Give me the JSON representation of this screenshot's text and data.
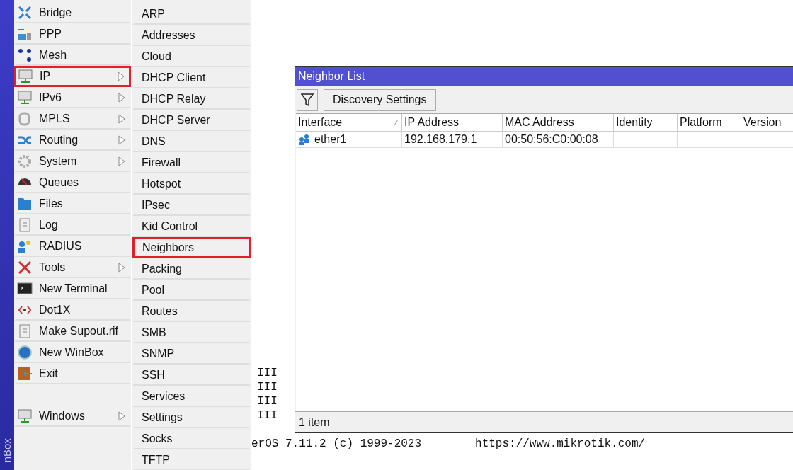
{
  "side_strip": {
    "label": "nBox"
  },
  "main_menu": [
    {
      "label": "Bridge",
      "submenu": false,
      "highlighted": false
    },
    {
      "label": "PPP",
      "submenu": false,
      "highlighted": false
    },
    {
      "label": "Mesh",
      "submenu": false,
      "highlighted": false
    },
    {
      "label": "IP",
      "submenu": true,
      "highlighted": true
    },
    {
      "label": "IPv6",
      "submenu": true,
      "highlighted": false
    },
    {
      "label": "MPLS",
      "submenu": true,
      "highlighted": false
    },
    {
      "label": "Routing",
      "submenu": true,
      "highlighted": false
    },
    {
      "label": "System",
      "submenu": true,
      "highlighted": false
    },
    {
      "label": "Queues",
      "submenu": false,
      "highlighted": false
    },
    {
      "label": "Files",
      "submenu": false,
      "highlighted": false
    },
    {
      "label": "Log",
      "submenu": false,
      "highlighted": false
    },
    {
      "label": "RADIUS",
      "submenu": false,
      "highlighted": false
    },
    {
      "label": "Tools",
      "submenu": true,
      "highlighted": false
    },
    {
      "label": "New Terminal",
      "submenu": false,
      "highlighted": false
    },
    {
      "label": "Dot1X",
      "submenu": false,
      "highlighted": false
    },
    {
      "label": "Make Supout.rif",
      "submenu": false,
      "highlighted": false
    },
    {
      "label": "New WinBox",
      "submenu": false,
      "highlighted": false
    },
    {
      "label": "Exit",
      "submenu": false,
      "highlighted": false
    },
    {
      "label": "Windows",
      "submenu": true,
      "highlighted": false,
      "gap_before": true
    }
  ],
  "ip_submenu": [
    {
      "label": "ARP",
      "highlighted": false
    },
    {
      "label": "Addresses",
      "highlighted": false
    },
    {
      "label": "Cloud",
      "highlighted": false
    },
    {
      "label": "DHCP Client",
      "highlighted": false
    },
    {
      "label": "DHCP Relay",
      "highlighted": false
    },
    {
      "label": "DHCP Server",
      "highlighted": false
    },
    {
      "label": "DNS",
      "highlighted": false
    },
    {
      "label": "Firewall",
      "highlighted": false
    },
    {
      "label": "Hotspot",
      "highlighted": false
    },
    {
      "label": "IPsec",
      "highlighted": false
    },
    {
      "label": "Kid Control",
      "highlighted": false
    },
    {
      "label": "Neighbors",
      "highlighted": true
    },
    {
      "label": "Packing",
      "highlighted": false
    },
    {
      "label": "Pool",
      "highlighted": false
    },
    {
      "label": "Routes",
      "highlighted": false
    },
    {
      "label": "SMB",
      "highlighted": false
    },
    {
      "label": "SNMP",
      "highlighted": false
    },
    {
      "label": "SSH",
      "highlighted": false
    },
    {
      "label": "Services",
      "highlighted": false
    },
    {
      "label": "Settings",
      "highlighted": false
    },
    {
      "label": "Socks",
      "highlighted": false
    },
    {
      "label": "TFTP",
      "highlighted": false
    }
  ],
  "terminal": {
    "lines": [
      "III",
      "III",
      "III",
      "III"
    ],
    "footer_left": "erOS 7.11.2 (c) 1999-2023",
    "footer_right": "https://www.mikrotik.com/"
  },
  "neighbor_window": {
    "title": "Neighbor List",
    "toolbar": {
      "button": "Discovery Settings"
    },
    "table": {
      "columns": [
        {
          "label": "Interface",
          "sorted": true
        },
        {
          "label": "IP Address",
          "sorted": false
        },
        {
          "label": "MAC Address",
          "sorted": false
        },
        {
          "label": "Identity",
          "sorted": false
        },
        {
          "label": "Platform",
          "sorted": false
        },
        {
          "label": "Version",
          "sorted": false
        }
      ],
      "rows": [
        {
          "cells": [
            "ether1",
            "192.168.179.1",
            "00:50:56:C0:00:08",
            "",
            "",
            ""
          ]
        }
      ]
    },
    "status_bar": "1 item"
  }
}
